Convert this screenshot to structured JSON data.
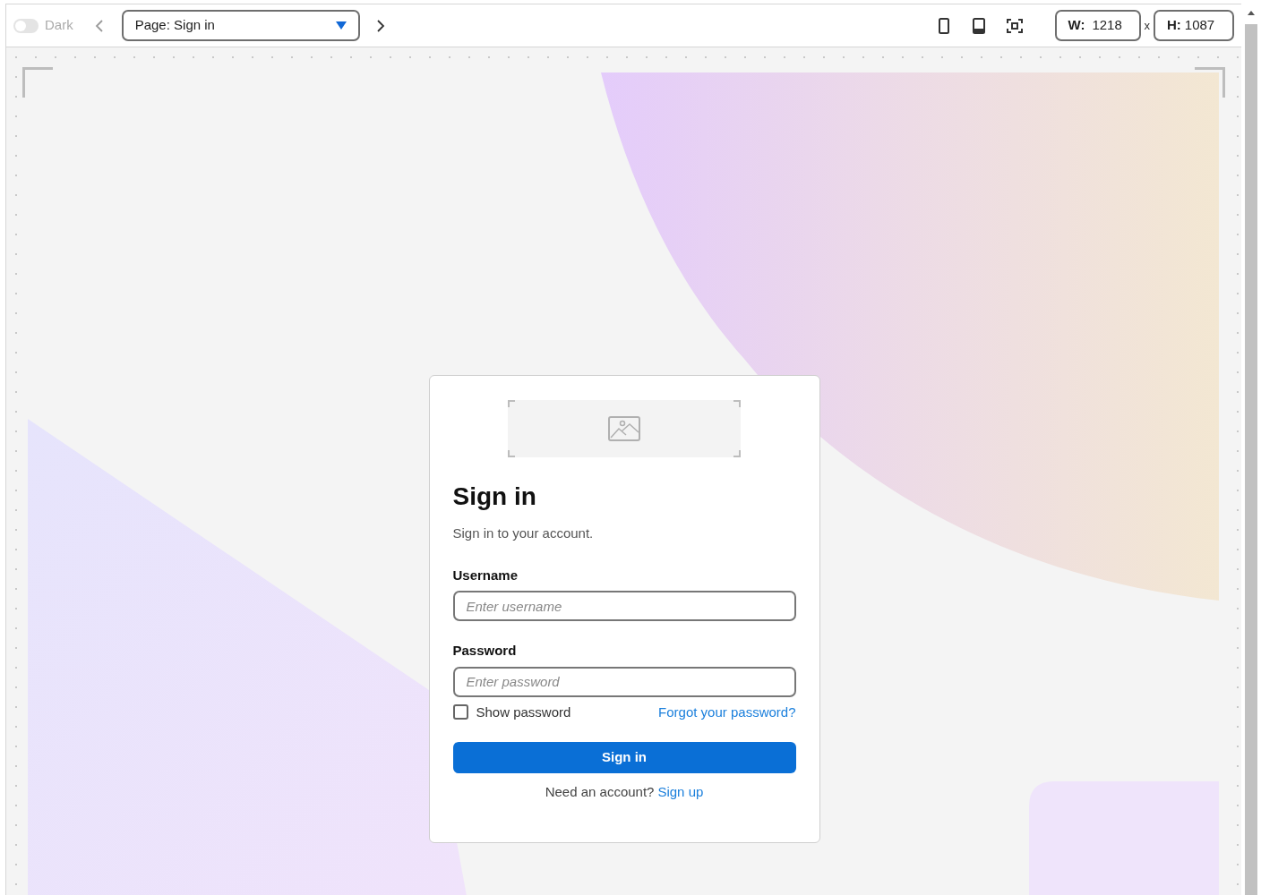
{
  "toolbar": {
    "dark_toggle": {
      "label": "Dark",
      "on": false
    },
    "page_select": {
      "value": "Page: Sign in"
    },
    "width": {
      "label": "W:",
      "value": "1218"
    },
    "separator": "x",
    "height": {
      "label": "H:",
      "value": "1087"
    }
  },
  "card": {
    "title": "Sign in",
    "subtitle": "Sign in to your account.",
    "fields": [
      {
        "label": "Username",
        "placeholder": "Enter username"
      },
      {
        "label": "Password",
        "placeholder": "Enter password"
      }
    ],
    "show_password": {
      "label": "Show password",
      "checked": false
    },
    "forgot_link": "Forgot your password?",
    "submit": "Sign in",
    "footer": {
      "text": "Need an account?",
      "link": "Sign up"
    }
  }
}
